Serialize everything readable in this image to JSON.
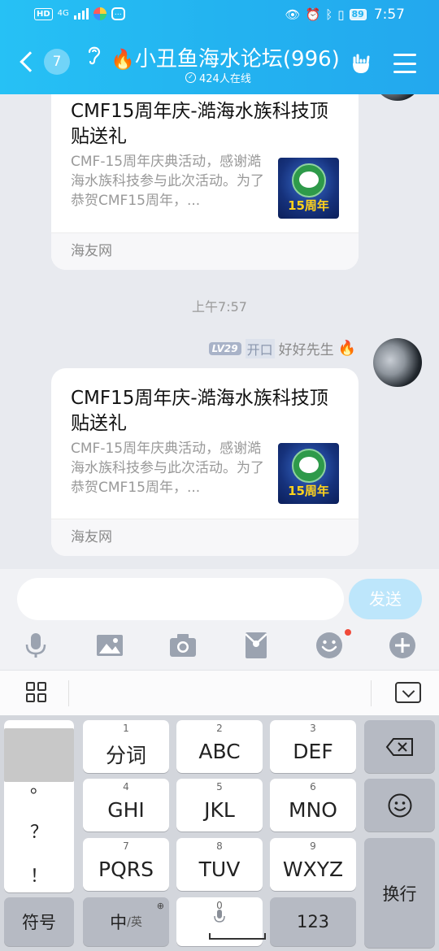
{
  "status_bar": {
    "left": {
      "hd": "HD",
      "network": "4G"
    },
    "battery": "89",
    "time": "7:57"
  },
  "header": {
    "back_count": "7",
    "title": "小丑鱼海水论坛(996)",
    "online": "424人在线"
  },
  "messages": [
    {
      "title": "CMF15周年庆-澔海水族科技顶贴送礼",
      "desc": "CMF-15周年庆典活动，感谢澔海水族科技参与此次活动。为了恭贺CMF15周年，...",
      "thumb_text": "15周年",
      "source": "海友网"
    },
    {
      "timestamp": "上午7:57",
      "sender": {
        "level": "LV29",
        "tag": "开口",
        "name": "好好先生"
      },
      "title": "CMF15周年庆-澔海水族科技顶贴送礼",
      "desc": "CMF-15周年庆典活动，感谢澔海水族科技参与此次活动。为了恭贺CMF15周年，...",
      "thumb_text": "15周年",
      "source": "海友网"
    }
  ],
  "input": {
    "placeholder": "",
    "send_label": "发送"
  },
  "toolbar": {
    "icons": [
      "microphone-icon",
      "image-icon",
      "camera-icon",
      "red-packet-icon",
      "emoji-icon",
      "plus-icon"
    ],
    "accent": "#9ba3b0"
  },
  "keyboard": {
    "punctuation": [
      "，",
      "。",
      "？",
      "！"
    ],
    "keys": [
      {
        "num": "1",
        "label": "分词"
      },
      {
        "num": "2",
        "label": "ABC"
      },
      {
        "num": "3",
        "label": "DEF"
      },
      {
        "num": "4",
        "label": "GHI"
      },
      {
        "num": "5",
        "label": "JKL"
      },
      {
        "num": "6",
        "label": "MNO"
      },
      {
        "num": "7",
        "label": "PQRS"
      },
      {
        "num": "8",
        "label": "TUV"
      },
      {
        "num": "9",
        "label": "WXYZ"
      }
    ],
    "symbols_label": "符号",
    "lang_label": "中",
    "lang_sub": "/英",
    "space_num": "0",
    "num_label": "123",
    "enter_label": "换行"
  },
  "colors": {
    "header_start": "#26c1f5",
    "header_end": "#23a8ee",
    "send_button": "#bde6fb",
    "chat_bg": "#e8eaef"
  }
}
